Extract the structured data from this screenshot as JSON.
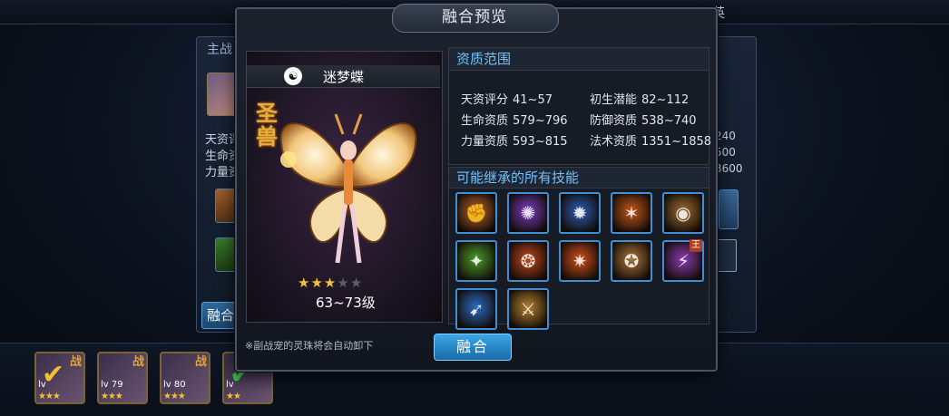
{
  "background": {
    "top_text": "英",
    "panel_title": "主战",
    "stats": [
      "天资评",
      "生命资",
      "力量资"
    ],
    "right_values": [
      "240",
      "500",
      "3600"
    ],
    "merge_button": "融合"
  },
  "bottom_pets": [
    {
      "level": "lv",
      "stars": "★★★",
      "tag": "战",
      "check": "✔",
      "check_color": "yellow"
    },
    {
      "level": "lv 79",
      "stars": "★★★",
      "tag": "战",
      "check": "",
      "check_color": ""
    },
    {
      "level": "lv 80",
      "stars": "★★★",
      "tag": "战",
      "check": "",
      "check_color": ""
    },
    {
      "level": "lv",
      "stars": "★★",
      "tag": "",
      "check": "✔",
      "check_color": "green"
    }
  ],
  "modal": {
    "title": "融合预览",
    "pet": {
      "name": "迷梦蝶",
      "type_icon": "yin-yang-icon",
      "tag": "圣兽",
      "stars_filled": 3,
      "stars_total": 5,
      "level_range": "63~73级"
    },
    "aptitude": {
      "title": "资质范围",
      "stats": [
        {
          "label": "天资评分",
          "value": "41~57"
        },
        {
          "label": "初生潜能",
          "value": "82~112"
        },
        {
          "label": "生命资质",
          "value": "579~796"
        },
        {
          "label": "防御资质",
          "value": "538~740"
        },
        {
          "label": "力量资质",
          "value": "593~815"
        },
        {
          "label": "法术资质",
          "value": "1351~1858"
        }
      ]
    },
    "skills": {
      "title": "可能继承的所有技能",
      "items": [
        {
          "icon": "fist-strike-icon",
          "color": "#b5622a"
        },
        {
          "icon": "purple-burst-icon",
          "color": "#7a3cc0"
        },
        {
          "icon": "blue-vortex-icon",
          "color": "#2a5bb0"
        },
        {
          "icon": "fire-claw-icon",
          "color": "#c2561c"
        },
        {
          "icon": "earth-rock-icon",
          "color": "#9a6a30"
        },
        {
          "icon": "green-orb-icon",
          "color": "#4a9a2a"
        },
        {
          "icon": "flame-ring-icon",
          "color": "#c0461c"
        },
        {
          "icon": "phoenix-icon",
          "color": "#d0501a"
        },
        {
          "icon": "beast-roar-icon",
          "color": "#a8743a"
        },
        {
          "icon": "purple-chain-icon",
          "color": "#8a3ab0"
        },
        {
          "icon": "blue-blade-icon",
          "color": "#2a6ac0"
        },
        {
          "icon": "gold-slash-icon",
          "color": "#b08030"
        }
      ],
      "badge": "王"
    },
    "hint": "※副战宠的灵珠将会自动卸下",
    "merge_button": "融合"
  }
}
